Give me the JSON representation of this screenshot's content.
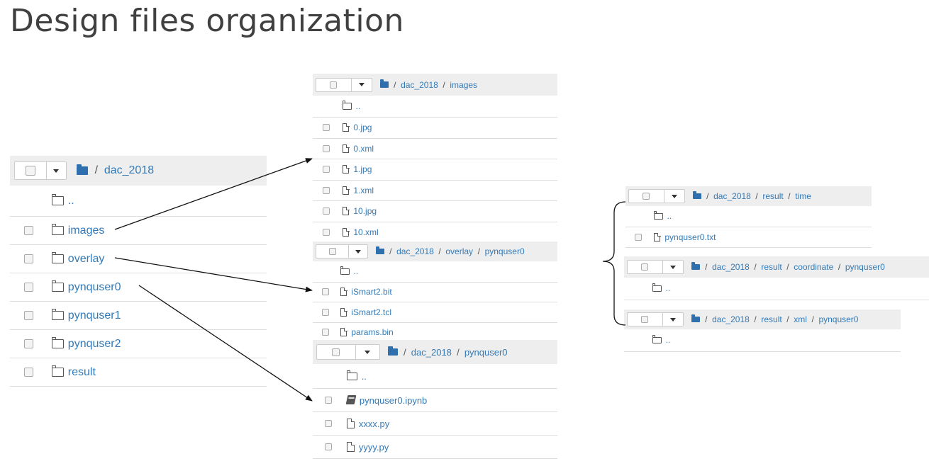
{
  "title": "Design files organization",
  "panels": {
    "root": {
      "crumbs": [
        "dac_2018"
      ],
      "items": [
        {
          "name": "..",
          "icon": "folder-icon",
          "checkbox": false
        },
        {
          "name": "images",
          "icon": "folder-icon",
          "checkbox": true
        },
        {
          "name": "overlay",
          "icon": "folder-icon",
          "checkbox": true
        },
        {
          "name": "pynquser0",
          "icon": "folder-icon",
          "checkbox": true
        },
        {
          "name": "pynquser1",
          "icon": "folder-icon",
          "checkbox": true
        },
        {
          "name": "pynquser2",
          "icon": "folder-icon",
          "checkbox": true
        },
        {
          "name": "result",
          "icon": "folder-icon",
          "checkbox": true
        }
      ]
    },
    "images": {
      "crumbs": [
        "dac_2018",
        "images"
      ],
      "items": [
        {
          "name": "..",
          "icon": "folder-icon",
          "checkbox": false
        },
        {
          "name": "0.jpg",
          "icon": "file-icon",
          "checkbox": true
        },
        {
          "name": "0.xml",
          "icon": "file-icon",
          "checkbox": true
        },
        {
          "name": "1.jpg",
          "icon": "file-icon",
          "checkbox": true
        },
        {
          "name": "1.xml",
          "icon": "file-icon",
          "checkbox": true
        },
        {
          "name": "10.jpg",
          "icon": "file-icon",
          "checkbox": true
        },
        {
          "name": "10.xml",
          "icon": "file-icon",
          "checkbox": true
        }
      ]
    },
    "overlay": {
      "crumbs": [
        "dac_2018",
        "overlay",
        "pynquser0"
      ],
      "items": [
        {
          "name": "..",
          "icon": "folder-icon",
          "checkbox": false
        },
        {
          "name": "iSmart2.bit",
          "icon": "file-icon",
          "checkbox": true
        },
        {
          "name": "iSmart2.tcl",
          "icon": "file-icon",
          "checkbox": true
        },
        {
          "name": "params.bin",
          "icon": "file-icon",
          "checkbox": true
        }
      ]
    },
    "pynquser0": {
      "crumbs": [
        "dac_2018",
        "pynquser0"
      ],
      "items": [
        {
          "name": "..",
          "icon": "folder-icon",
          "checkbox": false
        },
        {
          "name": "pynquser0.ipynb",
          "icon": "notebook-icon",
          "checkbox": true
        },
        {
          "name": "xxxx.py",
          "icon": "file-icon",
          "checkbox": true
        },
        {
          "name": "yyyy.py",
          "icon": "file-icon",
          "checkbox": true
        }
      ]
    },
    "time": {
      "crumbs": [
        "dac_2018",
        "result",
        "time"
      ],
      "items": [
        {
          "name": "..",
          "icon": "folder-icon",
          "checkbox": false
        },
        {
          "name": "pynquser0.txt",
          "icon": "file-icon",
          "checkbox": true
        }
      ]
    },
    "coordinate": {
      "crumbs": [
        "dac_2018",
        "result",
        "coordinate",
        "pynquser0"
      ],
      "items": [
        {
          "name": "..",
          "icon": "folder-icon",
          "checkbox": false
        }
      ]
    },
    "xml": {
      "crumbs": [
        "dac_2018",
        "result",
        "xml",
        "pynquser0"
      ],
      "items": [
        {
          "name": "..",
          "icon": "folder-icon",
          "checkbox": false
        }
      ]
    }
  },
  "colors": {
    "link": "#337ab7",
    "header_bg": "#eeeeee",
    "folder": "#2f6fad",
    "title": "#404040"
  }
}
